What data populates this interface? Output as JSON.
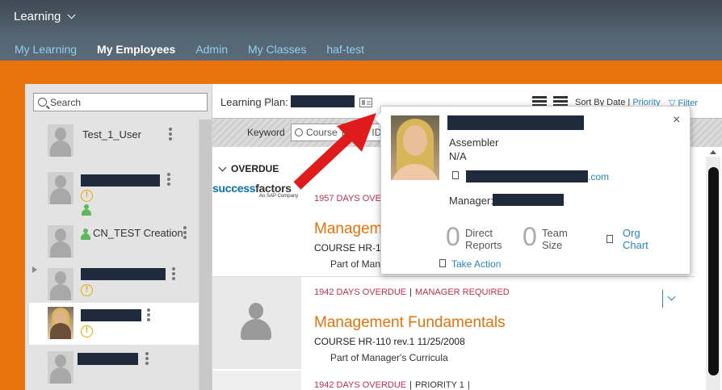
{
  "header": {
    "app_title": "Learning",
    "tabs": [
      "My Learning",
      "My Employees",
      "Admin",
      "My Classes",
      "haf-test"
    ],
    "active_tab": "My Employees"
  },
  "sidebar": {
    "search_placeholder": "Search",
    "employees": [
      {
        "name": "Test_1_User",
        "redacted": false,
        "warning": false,
        "green_person": false,
        "photo": false
      },
      {
        "name": "",
        "redacted": true,
        "warning": true,
        "green_person": true,
        "photo": false
      },
      {
        "name": "CN_TEST Creation",
        "redacted": false,
        "warning": false,
        "green_person": true,
        "photo": false
      },
      {
        "name": "",
        "redacted": true,
        "warning": true,
        "green_person": false,
        "photo": false,
        "expandable": true
      },
      {
        "name": "",
        "redacted": true,
        "warning": true,
        "green_person": false,
        "photo": true,
        "selected": true
      },
      {
        "name": "",
        "redacted": true,
        "warning": false,
        "green_person": false,
        "photo": false
      }
    ]
  },
  "content": {
    "learning_plan_label": "Learning Plan:",
    "sort_by_label": "Sort By Date",
    "sort_sep": "|",
    "sort_priority": "Priority",
    "filter_label": "Filter",
    "keyword_label": "Keyword",
    "keyword_placeholder": "Course Title or ID",
    "section_overdue": "OVERDUE",
    "logo": {
      "text_a": "success",
      "text_b": "factors",
      "sub": "An SAP Company"
    },
    "cards": [
      {
        "meta": "1957 DAYS OVERDUE",
        "title": "Management Fundamentals",
        "course": "COURSE HR-110 rev.1 11/25/2008",
        "part": "Part of Manager's Curricula"
      },
      {
        "meta": "1942 DAYS OVERDUE",
        "meta_extra": "MANAGER REQUIRED",
        "title": "Management Fundamentals",
        "course": "COURSE HR-110 rev.1 11/25/2008",
        "part": "Part of Manager's Curricula"
      },
      {
        "meta": "1942 DAYS OVERDUE",
        "meta_extra": "PRIORITY 1"
      }
    ]
  },
  "popover": {
    "job_title": "Assembler",
    "department": "N/A",
    "email_suffix": ".com",
    "manager_label": "Manager:",
    "direct_reports_count": "0",
    "direct_reports_label_1": "Direct",
    "direct_reports_label_2": "Reports",
    "team_size_count": "0",
    "team_size_label_1": "Team",
    "team_size_label_2": "Size",
    "org_chart_1": "Org",
    "org_chart_2": "Chart",
    "take_action": "Take Action",
    "close": "×"
  },
  "colors": {
    "header_bg": "#4a5866",
    "orange": "#e8720c",
    "link_blue": "#2a86c5",
    "overdue_red": "#c0314a",
    "title_orange": "#e8720c",
    "redaction": "#1f2b3d"
  }
}
